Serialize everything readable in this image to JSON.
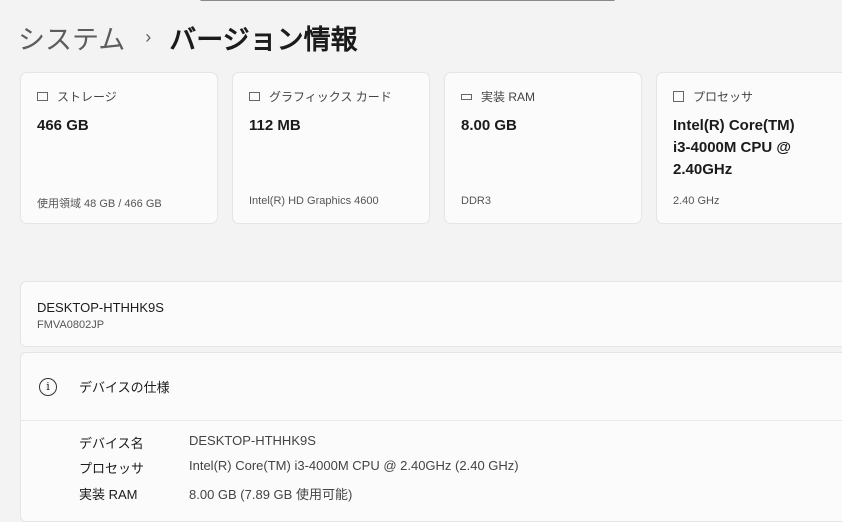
{
  "breadcrumb": {
    "parent": "システム",
    "separator": "›",
    "current": "バージョン情報"
  },
  "cards": [
    {
      "label": "ストレージ",
      "value": "466 GB",
      "sub": "使用領域 48 GB / 466 GB",
      "icon": "storage-icon"
    },
    {
      "label": "グラフィックス カード",
      "value": "112 MB",
      "sub": "Intel(R) HD Graphics 4600",
      "icon": "gpu-icon"
    },
    {
      "label": "実装 RAM",
      "value": "8.00 GB",
      "sub": "DDR3",
      "icon": "ram-icon"
    },
    {
      "label": "プロセッサ",
      "value": "Intel(R) Core(TM) i3-4000M CPU @ 2.40GHz",
      "sub": "2.40 GHz",
      "icon": "cpu-icon"
    }
  ],
  "device": {
    "name": "DESKTOP-HTHHK9S",
    "model": "FMVA0802JP"
  },
  "specs": {
    "title": "デバイスの仕様",
    "rows": [
      {
        "key": "デバイス名",
        "value": "DESKTOP-HTHHK9S"
      },
      {
        "key": "プロセッサ",
        "value": "Intel(R) Core(TM) i3-4000M CPU @ 2.40GHz (2.40 GHz)"
      },
      {
        "key": "実装 RAM",
        "value": "8.00 GB (7.89 GB 使用可能)"
      }
    ]
  }
}
